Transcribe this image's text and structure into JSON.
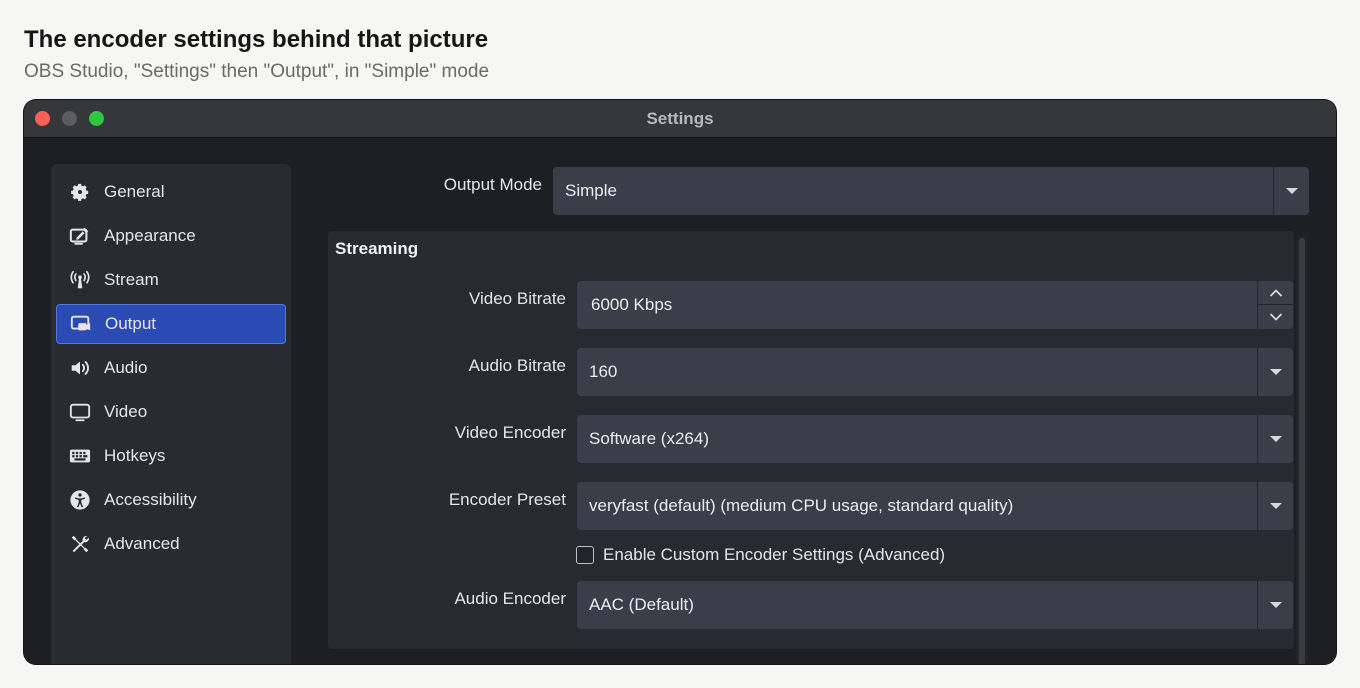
{
  "caption": {
    "title": "The encoder settings behind that picture",
    "subtitle": "OBS Studio, \"Settings\" then \"Output\", in \"Simple\" mode"
  },
  "window": {
    "title": "Settings"
  },
  "sidebar": {
    "items": [
      {
        "label": "General",
        "icon": "gear-icon"
      },
      {
        "label": "Appearance",
        "icon": "appearance-icon"
      },
      {
        "label": "Stream",
        "icon": "antenna-icon"
      },
      {
        "label": "Output",
        "icon": "output-icon",
        "active": true
      },
      {
        "label": "Audio",
        "icon": "speaker-icon"
      },
      {
        "label": "Video",
        "icon": "monitor-icon"
      },
      {
        "label": "Hotkeys",
        "icon": "keyboard-icon"
      },
      {
        "label": "Accessibility",
        "icon": "accessibility-icon"
      },
      {
        "label": "Advanced",
        "icon": "tools-icon"
      }
    ]
  },
  "output_mode": {
    "label": "Output Mode",
    "value": "Simple"
  },
  "streaming": {
    "title": "Streaming",
    "video_bitrate": {
      "label": "Video Bitrate",
      "value": "6000 Kbps"
    },
    "audio_bitrate": {
      "label": "Audio Bitrate",
      "value": "160"
    },
    "video_encoder": {
      "label": "Video Encoder",
      "value": "Software (x264)"
    },
    "encoder_preset": {
      "label": "Encoder Preset",
      "value": "veryfast (default) (medium CPU usage, standard quality)"
    },
    "custom_encoder": {
      "label": "Enable Custom Encoder Settings (Advanced)",
      "checked": false
    },
    "audio_encoder": {
      "label": "Audio Encoder",
      "value": "AAC (Default)"
    }
  },
  "colors": {
    "accent": "#2a4bb3",
    "window_bg": "#1e1f25",
    "panel_bg": "#282a32",
    "field_bg": "#3b3d48"
  }
}
